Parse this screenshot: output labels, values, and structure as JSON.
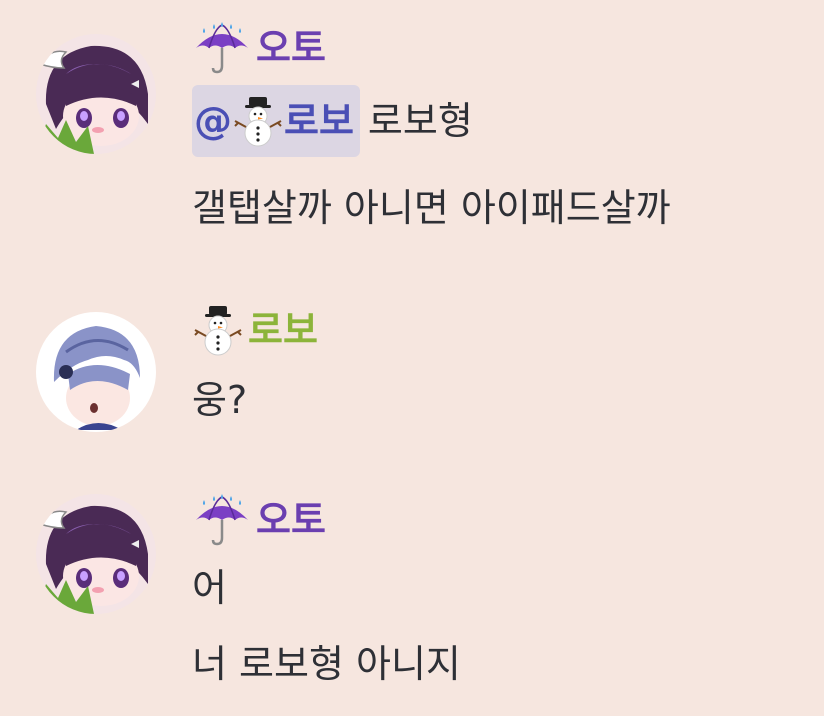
{
  "messages": [
    {
      "author": "오토",
      "author_color": "#6b3fb0",
      "author_icon": "umbrella-rain-icon",
      "mention": {
        "prefix": "@",
        "icon": "snowman-icon",
        "name": "로보"
      },
      "lines": [
        "로보형",
        "갤탭살까 아니면 아이패드살까"
      ]
    },
    {
      "author": "로보",
      "author_color": "#8cb43a",
      "author_icon": "snowman-icon",
      "lines": [
        "웅?"
      ]
    },
    {
      "author": "오토",
      "author_color": "#6b3fb0",
      "author_icon": "umbrella-rain-icon",
      "lines": [
        "어",
        "너 로보형 아니지"
      ]
    }
  ],
  "colors": {
    "background": "#f6e6df",
    "text": "#2e3036",
    "mention_bg": "#dcd6e3",
    "mention_text": "#4a4fb5"
  }
}
